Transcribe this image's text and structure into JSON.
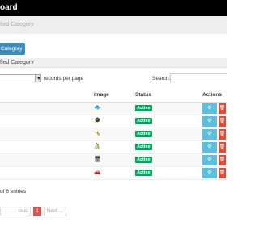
{
  "header": {
    "title": "oard"
  },
  "breadcrumb": {
    "text": "fied Category"
  },
  "add_button": {
    "label": "Category"
  },
  "panel": {
    "title": "fied Category"
  },
  "table_controls": {
    "records_per_page_label": "records per page",
    "search_label": "Search:",
    "search_placeholder": ""
  },
  "table": {
    "columns": [
      "Image",
      "Status",
      "Actions"
    ],
    "rows": [
      {
        "image_icon": "image-icon",
        "status": "Active"
      },
      {
        "image_icon": "image-icon",
        "status": "Active"
      },
      {
        "image_icon": "image-icon",
        "status": "Active"
      },
      {
        "image_icon": "image-icon",
        "status": "Active"
      },
      {
        "image_icon": "image-icon",
        "status": "Active"
      },
      {
        "image_icon": "image-icon",
        "status": "Active"
      }
    ],
    "view_button_glyph": "⚙",
    "delete_button_glyph": "🗑"
  },
  "info_text": "of 6 entries",
  "pagination": {
    "prev": "ious",
    "current": "1",
    "next": "Next →"
  },
  "colors": {
    "topbar": "#000000",
    "primary": "#3c8dbc",
    "success": "#00a65a",
    "info": "#5bc0de",
    "danger": "#dd4b39"
  }
}
